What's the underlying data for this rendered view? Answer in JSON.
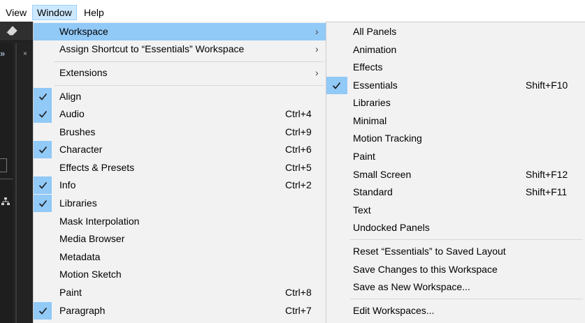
{
  "menubar": {
    "items": [
      {
        "label": "View"
      },
      {
        "label": "Window"
      },
      {
        "label": "Help"
      }
    ]
  },
  "window_menu": {
    "items": [
      {
        "label": "Workspace",
        "shortcut": "",
        "checked": false,
        "submenu": true,
        "highlighted": true
      },
      {
        "label": "Assign Shortcut to “Essentials” Workspace",
        "shortcut": "",
        "checked": false,
        "submenu": true
      },
      {
        "label": "Extensions",
        "shortcut": "",
        "checked": false,
        "submenu": true
      },
      {
        "label": "Align",
        "shortcut": "",
        "checked": true
      },
      {
        "label": "Audio",
        "shortcut": "Ctrl+4",
        "checked": true
      },
      {
        "label": "Brushes",
        "shortcut": "Ctrl+9",
        "checked": false
      },
      {
        "label": "Character",
        "shortcut": "Ctrl+6",
        "checked": true
      },
      {
        "label": "Effects & Presets",
        "shortcut": "Ctrl+5",
        "checked": false
      },
      {
        "label": "Info",
        "shortcut": "Ctrl+2",
        "checked": true
      },
      {
        "label": "Libraries",
        "shortcut": "",
        "checked": true
      },
      {
        "label": "Mask Interpolation",
        "shortcut": "",
        "checked": false
      },
      {
        "label": "Media Browser",
        "shortcut": "",
        "checked": false
      },
      {
        "label": "Metadata",
        "shortcut": "",
        "checked": false
      },
      {
        "label": "Motion Sketch",
        "shortcut": "",
        "checked": false
      },
      {
        "label": "Paint",
        "shortcut": "Ctrl+8",
        "checked": false
      },
      {
        "label": "Paragraph",
        "shortcut": "Ctrl+7",
        "checked": true
      }
    ],
    "submenu_arrow": "›"
  },
  "workspace_submenu": {
    "items": [
      {
        "label": "All Panels",
        "shortcut": "",
        "checked": false
      },
      {
        "label": "Animation",
        "shortcut": "",
        "checked": false
      },
      {
        "label": "Effects",
        "shortcut": "",
        "checked": false
      },
      {
        "label": "Essentials",
        "shortcut": "Shift+F10",
        "checked": true
      },
      {
        "label": "Libraries",
        "shortcut": "",
        "checked": false
      },
      {
        "label": "Minimal",
        "shortcut": "",
        "checked": false
      },
      {
        "label": "Motion Tracking",
        "shortcut": "",
        "checked": false
      },
      {
        "label": "Paint",
        "shortcut": "",
        "checked": false
      },
      {
        "label": "Small Screen",
        "shortcut": "Shift+F12",
        "checked": false
      },
      {
        "label": "Standard",
        "shortcut": "Shift+F11",
        "checked": false
      },
      {
        "label": "Text",
        "shortcut": "",
        "checked": false
      },
      {
        "label": "Undocked Panels",
        "shortcut": "",
        "checked": false
      },
      {
        "label": "Reset “Essentials” to Saved Layout",
        "shortcut": "",
        "checked": false
      },
      {
        "label": "Save Changes to this Workspace",
        "shortcut": "",
        "checked": false
      },
      {
        "label": "Save as New Workspace...",
        "shortcut": "",
        "checked": false
      },
      {
        "label": "Edit Workspaces...",
        "shortcut": "",
        "checked": false
      }
    ]
  },
  "background_app": {
    "expand_glyph": "»",
    "close_glyph": "×"
  },
  "colors": {
    "highlight": "#91c9f7",
    "menu_bg": "#f2f2f2",
    "menubar_active_bg": "#cce8ff",
    "app_dark": "#232323"
  }
}
